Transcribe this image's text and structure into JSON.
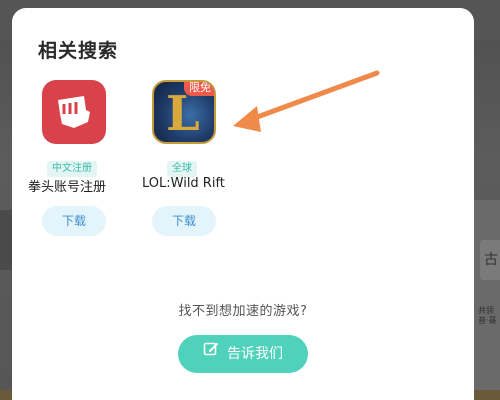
{
  "background": {
    "right_box_text": "古",
    "right_small_text": "共领\n音·哥"
  },
  "modal": {
    "title": "相关搜索",
    "apps": [
      {
        "name": "拳头账号注册",
        "tag": "中文注册",
        "download_label": "下载",
        "icon": "riot-fist-icon"
      },
      {
        "name": "LOL:Wild Rift",
        "tag": "全球",
        "badge": "限免",
        "download_label": "下载",
        "icon": "lol-logo-icon"
      }
    ],
    "prompt": "找不到想加速的游戏?",
    "tell_button_label": "告诉我们",
    "tell_button_icon": "edit-icon",
    "annotation_arrow_color": "#f08a4b"
  },
  "colors": {
    "accent": "#4fd1bb",
    "tag_text": "#3cbca8",
    "download_text": "#3f8fd0",
    "badge": "#f0584a"
  }
}
